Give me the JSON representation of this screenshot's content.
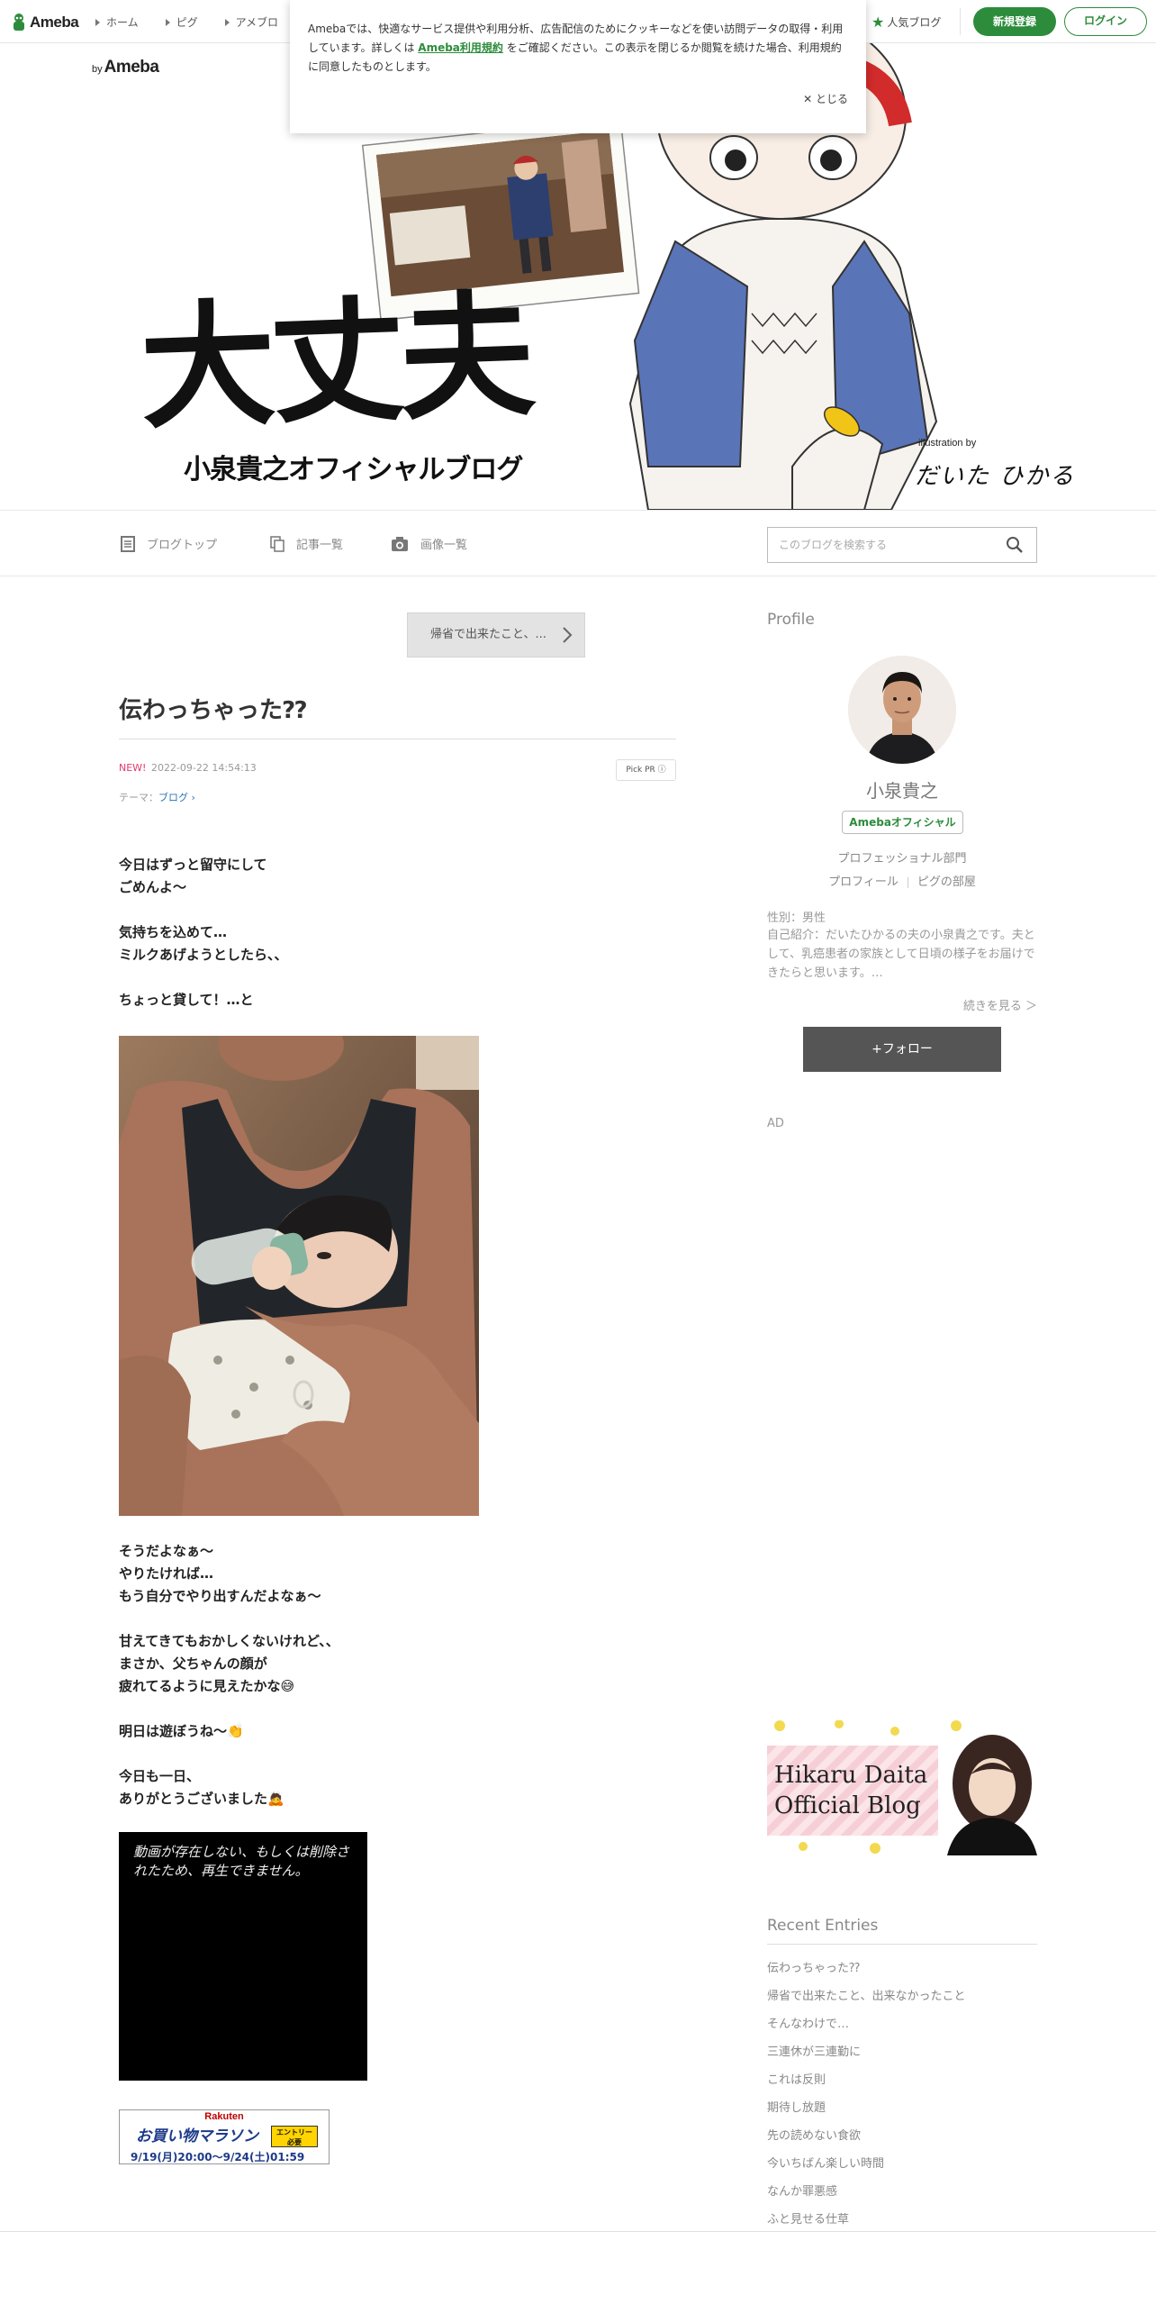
{
  "topnav": {
    "logo": "Ameba",
    "links": [
      "ホーム",
      "ピグ",
      "アメブロ"
    ],
    "popular": "人気ブログ",
    "register": "新規登録",
    "login": "ログイン"
  },
  "header": {
    "by": "by",
    "brand": "Ameba",
    "title": "大丈夫",
    "subtitle": "小泉貴之オフィシャルブログ",
    "credit": "illustration by",
    "signature": "だいた ひかる"
  },
  "cookie": {
    "text_before": "Amebaでは、快適なサービス提供や利用分析、広告配信のためにクッキーなどを使い訪問データの取得・利用しています。詳しくは",
    "link": "Ameba利用規約",
    "text_after": "をご確認ください。この表示を閉じるか閲覧を続けた場合、利用規約に同意したものとします。",
    "close": "✕ とじる"
  },
  "blogmenu": {
    "top": "ブログトップ",
    "list": "記事一覧",
    "images": "画像一覧",
    "search_placeholder": "このブログを検索する"
  },
  "entry": {
    "prev": "帰省で出来たこと、...",
    "title": "伝わっちゃった⁇",
    "new_label": "NEW!",
    "datetime": "2022-09-22 14:54:13",
    "pickpr": "Pick PR ⓘ",
    "theme_label": "テーマ：",
    "theme": "ブログ",
    "para1": "今日はずっと留守にして\nごめんよ〜\n\n気持ちを込めて…\nミルクあげようとしたら、、\n\nちょっと貸して！…と",
    "para2": "そうだよなぁ〜\nやりたければ…\nもう自分でやり出すんだよなぁ〜\n\n甘えてきてもおかしくないけれど、、\nまさか、父ちゃんの顔が\n疲れてるように見えたかな😅\n\n明日は遊ぼうね〜👏\n\n今日も一日、\nありがとうございました🙇",
    "video_message": "動画が存在しない、もしくは削除されたため、再生できません。",
    "rakuten_brand": "Rakuten",
    "rakuten_name": "お買い物マラソン",
    "rakuten_entry": "エントリー\n必要",
    "rakuten_dates": "9/19(月)20:00〜9/24(土)01:59"
  },
  "sidebar": {
    "profile_heading": "Profile",
    "name": "小泉貴之",
    "badge": "Amebaオフィシャル",
    "division": "プロフェッショナル部門",
    "link_profile": "プロフィール",
    "link_pig": "ピグの部屋",
    "gender": "性別：男性",
    "intro": "自己紹介：だいたひかるの夫の小泉貴之です。夫として、乳癌患者の家族として日頃の様子をお届けできたらと思います。…",
    "readmore": "続きを見る ＞",
    "follow": "+フォロー",
    "ad": "AD",
    "banner_line1": "Hikaru Daita",
    "banner_line2": "Official Blog",
    "recent_heading": "Recent Entries",
    "recent": [
      "伝わっちゃった⁇",
      "帰省で出来たこと、出来なかったこと",
      "そんなわけで…",
      "三連休が三連勤に",
      "これは反則",
      "期待し放題",
      "先の読めない食欲",
      "今いちばん楽しい時間",
      "なんか罪悪感",
      "ふと見せる仕草"
    ]
  },
  "colors": {
    "ameba_green": "#2d8c3c",
    "new_pink": "#e03a6a",
    "link_blue": "#2a73b8",
    "follow_gray": "#555555"
  }
}
